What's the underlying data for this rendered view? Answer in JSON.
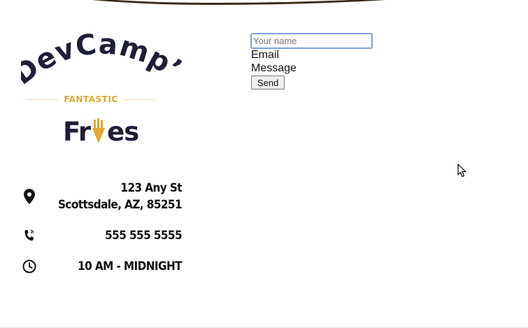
{
  "logo": {
    "brand_arc": "DevCamp’s",
    "tagline": "FANTASTIC",
    "product_prefix": "Fr",
    "product_suffix": "es"
  },
  "contact": {
    "address_line1": "123 Any St",
    "address_line2": "Scottsdale, AZ, 85251",
    "phone": "555 555 5555",
    "hours": "10 AM - MIDNIGHT"
  },
  "form": {
    "name_placeholder": "Your name",
    "name_value": "",
    "email_label": "Email",
    "message_label": "Message",
    "send_label": "Send"
  },
  "icons": {
    "address": "map-marker-icon",
    "phone": "phone-volume-icon",
    "hours": "clock-icon",
    "cursor": "mouse-pointer-icon"
  },
  "colors": {
    "brand_dark": "#1e1e36",
    "brand_gold": "#e2a72e",
    "text": "#111111",
    "focus_border": "#6b8fd6"
  }
}
